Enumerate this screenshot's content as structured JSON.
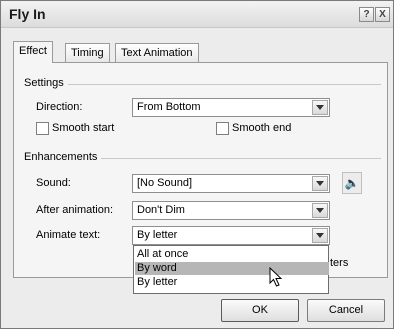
{
  "window": {
    "title": "Fly In",
    "help_label": "?",
    "close_label": "X"
  },
  "tabs": [
    {
      "label": "Effect",
      "active": true
    },
    {
      "label": "Timing",
      "active": false
    },
    {
      "label": "Text Animation",
      "active": false
    }
  ],
  "settings": {
    "heading": "Settings",
    "direction_label": "Direction:",
    "direction_value": "From Bottom",
    "smooth_start_label": "Smooth start",
    "smooth_start_checked": false,
    "smooth_end_label": "Smooth end",
    "smooth_end_checked": false
  },
  "enhancements": {
    "heading": "Enhancements",
    "sound_label": "Sound:",
    "sound_value": "[No Sound]",
    "after_animation_label": "After animation:",
    "after_animation_value": "Don't Dim",
    "animate_text_label": "Animate text:",
    "animate_text_value": "By letter",
    "dropdown_options": [
      "All at once",
      "By word",
      "By letter"
    ],
    "dropdown_highlighted": "By word",
    "partial_hidden_text": "ters"
  },
  "buttons": {
    "ok_label": "OK",
    "cancel_label": "Cancel"
  },
  "icons": {
    "sound": "speaker-icon",
    "cursor": "mouse-pointer-icon",
    "dropdown": "chevron-down-icon"
  }
}
